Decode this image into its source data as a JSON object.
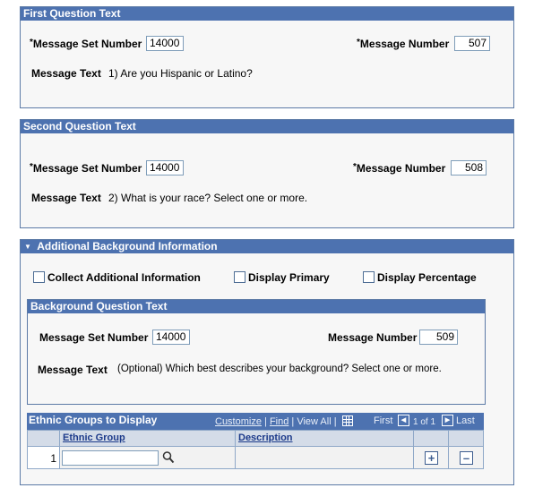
{
  "q1": {
    "title": "First Question Text",
    "msg_set_label": "Message Set Number",
    "msg_set_value": "14000",
    "msg_num_label": "Message Number",
    "msg_num_value": "507",
    "msg_text_label": "Message Text",
    "msg_text_value": "1) Are you Hispanic or Latino?"
  },
  "q2": {
    "title": "Second Question Text",
    "msg_set_label": "Message Set Number",
    "msg_set_value": "14000",
    "msg_num_label": "Message Number",
    "msg_num_value": "508",
    "msg_text_label": "Message Text",
    "msg_text_value": "2) What is your race?  Select one or more."
  },
  "additional": {
    "title": "Additional Background Information",
    "collect_label": "Collect Additional Information",
    "primary_label": "Display Primary",
    "percentage_label": "Display Percentage"
  },
  "background": {
    "title": "Background Question Text",
    "msg_set_label": "Message Set Number",
    "msg_set_value": "14000",
    "msg_num_label": "Message Number",
    "msg_num_value": "509",
    "msg_text_label": "Message Text",
    "msg_text_value": "(Optional) Which best describes your background? Select one or more."
  },
  "grid": {
    "title": "Ethnic Groups to Display",
    "customize": "Customize",
    "find": "Find",
    "view_all": "View All",
    "first": "First",
    "range": "1 of 1",
    "last": "Last",
    "col_group": "Ethnic Group",
    "col_desc": "Description",
    "rows": [
      {
        "num": "1",
        "group": "",
        "desc": ""
      }
    ]
  },
  "colors": {
    "header": "#4d72b0",
    "border": "#5c7aa6",
    "panel": "#f7f7f7"
  }
}
